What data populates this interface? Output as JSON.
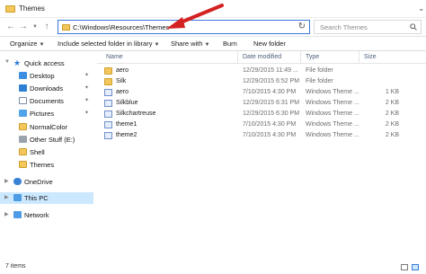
{
  "window": {
    "title": "Themes"
  },
  "address": {
    "path": "C:\\Windows\\Resources\\Themes",
    "back_icon": "arrow-left-icon",
    "forward_icon": "arrow-right-icon",
    "up_icon": "arrow-up-icon"
  },
  "search": {
    "placeholder": "Search Themes"
  },
  "toolbar": {
    "organize": "Organize",
    "include_library": "Include selected folder in library",
    "share_with": "Share with",
    "burn": "Burn",
    "new_folder": "New folder"
  },
  "sidebar": {
    "items": [
      {
        "label": "Quick access",
        "icon": "star-icon",
        "pinned": false
      },
      {
        "label": "Desktop",
        "icon": "desktop-icon",
        "pinned": true
      },
      {
        "label": "Downloads",
        "icon": "download-icon",
        "pinned": true
      },
      {
        "label": "Documents",
        "icon": "documents-icon",
        "pinned": true
      },
      {
        "label": "Pictures",
        "icon": "pictures-icon",
        "pinned": true
      },
      {
        "label": "NormalColor",
        "icon": "folder-icon",
        "pinned": false
      },
      {
        "label": "Other Stuff (E:)",
        "icon": "drive-icon",
        "pinned": false
      },
      {
        "label": "Shell",
        "icon": "folder-icon",
        "pinned": false
      },
      {
        "label": "Themes",
        "icon": "folder-icon",
        "pinned": false
      },
      {
        "label": "OneDrive",
        "icon": "cloud-icon",
        "pinned": false
      },
      {
        "label": "This PC",
        "icon": "computer-icon",
        "pinned": false
      },
      {
        "label": "Network",
        "icon": "network-icon",
        "pinned": false
      }
    ]
  },
  "columns": {
    "name": "Name",
    "date": "Date modified",
    "type": "Type",
    "size": "Size"
  },
  "files": [
    {
      "name": "aero",
      "date": "12/29/2015 11:49 ...",
      "type": "File folder",
      "size": "",
      "kind": "folder"
    },
    {
      "name": "Silk",
      "date": "12/29/2015 6:52 PM",
      "type": "File folder",
      "size": "",
      "kind": "folder"
    },
    {
      "name": "aero",
      "date": "7/10/2015 4:30 PM",
      "type": "Windows Theme ...",
      "size": "1 KB",
      "kind": "theme"
    },
    {
      "name": "Silkblue",
      "date": "12/29/2015 6:31 PM",
      "type": "Windows Theme ...",
      "size": "2 KB",
      "kind": "theme"
    },
    {
      "name": "Silkchartreuse",
      "date": "12/29/2015 6:30 PM",
      "type": "Windows Theme ...",
      "size": "2 KB",
      "kind": "theme"
    },
    {
      "name": "theme1",
      "date": "7/10/2015 4:30 PM",
      "type": "Windows Theme ...",
      "size": "2 KB",
      "kind": "theme"
    },
    {
      "name": "theme2",
      "date": "7/10/2015 4:30 PM",
      "type": "Windows Theme ...",
      "size": "2 KB",
      "kind": "theme"
    }
  ],
  "status": {
    "item_count": "7 items"
  },
  "colors": {
    "accent": "#3a79d7",
    "selection": "#cce8ff",
    "annotation_arrow": "#d42121",
    "folder": "#f3c75c"
  }
}
